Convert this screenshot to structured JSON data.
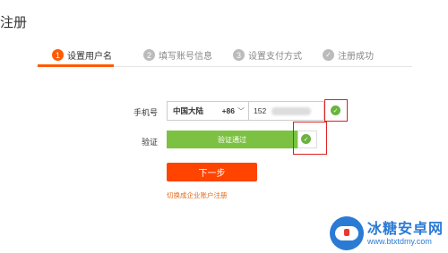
{
  "page": {
    "title": "注册"
  },
  "steps": [
    {
      "number": "1",
      "label": "设置用户名",
      "state": "active"
    },
    {
      "number": "2",
      "label": "填写账号信息",
      "state": "pending"
    },
    {
      "number": "3",
      "label": "设置支付方式",
      "state": "pending"
    },
    {
      "number": "",
      "label": "注册成功",
      "state": "pending"
    }
  ],
  "form": {
    "phone_label": "手机号",
    "country_name": "中国大陆",
    "country_code": "+86",
    "phone_value": "152",
    "verify_label": "验证",
    "verify_status": "验证通过",
    "next_button": "下一步",
    "enterprise_link": "切换成企业账户注册"
  },
  "watermark": {
    "title": "冰糖安卓网",
    "url": "www.btxtdmy.com"
  },
  "colors": {
    "accent": "#ff5a00",
    "success": "#7dc142",
    "highlight": "#e01e1e",
    "button": "#ff4400"
  }
}
